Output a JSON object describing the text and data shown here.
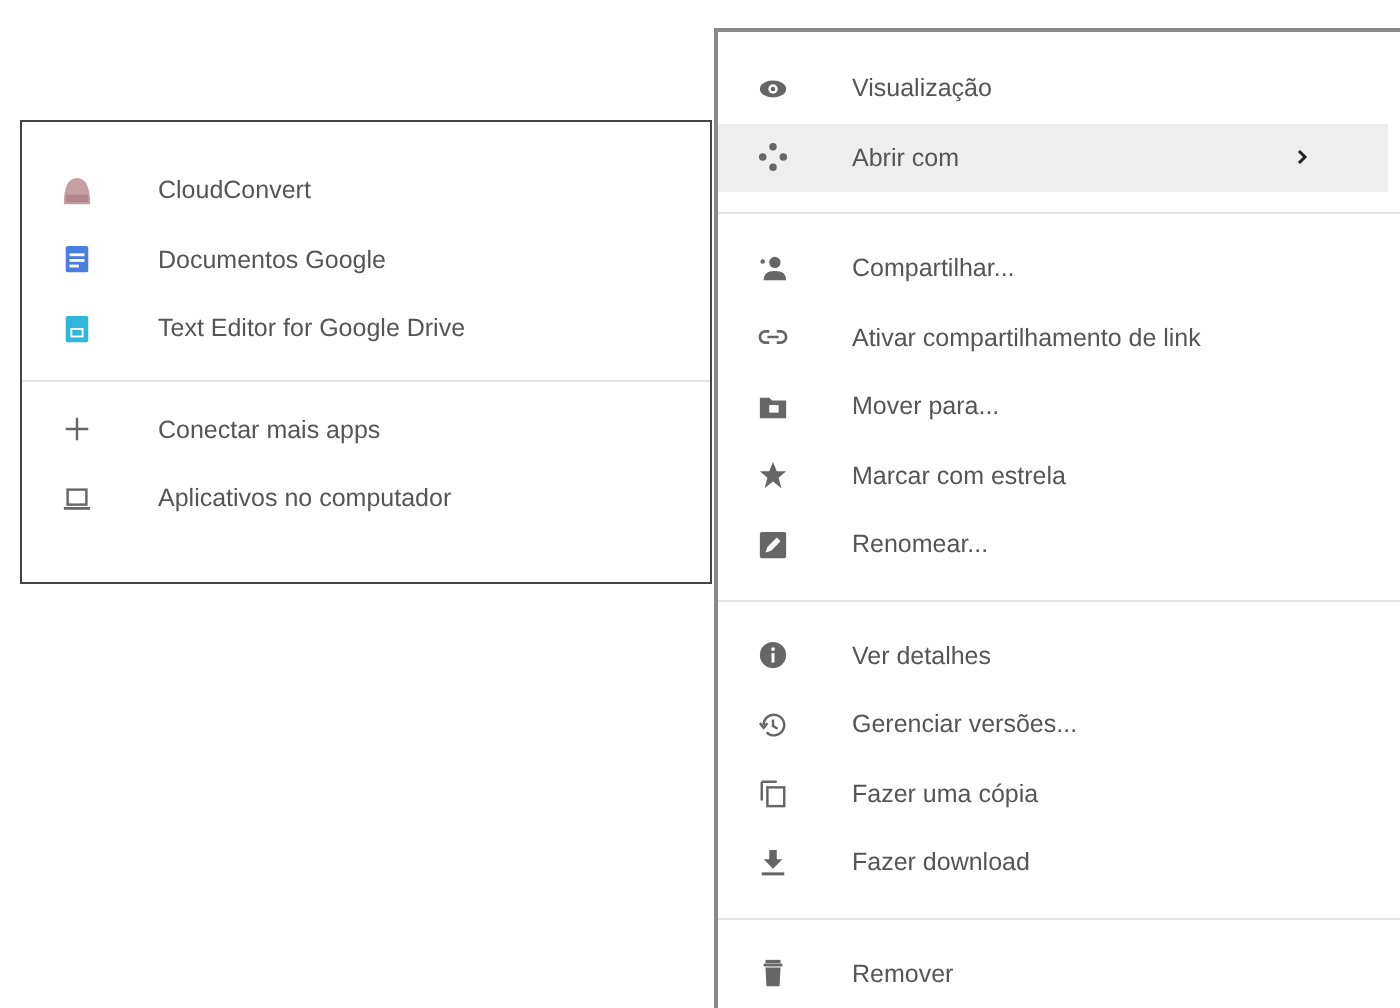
{
  "open_with_submenu": {
    "groups": [
      {
        "items": [
          {
            "label": "CloudConvert"
          },
          {
            "label": "Documentos Google"
          },
          {
            "label": "Text Editor for Google Drive"
          }
        ]
      },
      {
        "items": [
          {
            "label": "Conectar mais apps"
          },
          {
            "label": "Aplicativos no computador"
          }
        ]
      }
    ]
  },
  "context_menu": {
    "groups": [
      {
        "items": [
          {
            "label": "Visualização",
            "selected": false,
            "has_submenu": false
          },
          {
            "label": "Abrir com",
            "selected": true,
            "has_submenu": true
          }
        ]
      },
      {
        "items": [
          {
            "label": "Compartilhar...",
            "selected": false,
            "has_submenu": false
          },
          {
            "label": "Ativar compartilhamento de link",
            "selected": false,
            "has_submenu": false
          },
          {
            "label": "Mover para...",
            "selected": false,
            "has_submenu": false
          },
          {
            "label": "Marcar com estrela",
            "selected": false,
            "has_submenu": false
          },
          {
            "label": "Renomear...",
            "selected": false,
            "has_submenu": false
          }
        ]
      },
      {
        "items": [
          {
            "label": "Ver detalhes",
            "selected": false,
            "has_submenu": false
          },
          {
            "label": "Gerenciar versões...",
            "selected": false,
            "has_submenu": false
          },
          {
            "label": "Fazer uma cópia",
            "selected": false,
            "has_submenu": false
          },
          {
            "label": "Fazer download",
            "selected": false,
            "has_submenu": false
          }
        ]
      },
      {
        "items": [
          {
            "label": "Remover",
            "selected": false,
            "has_submenu": false
          }
        ]
      }
    ]
  }
}
